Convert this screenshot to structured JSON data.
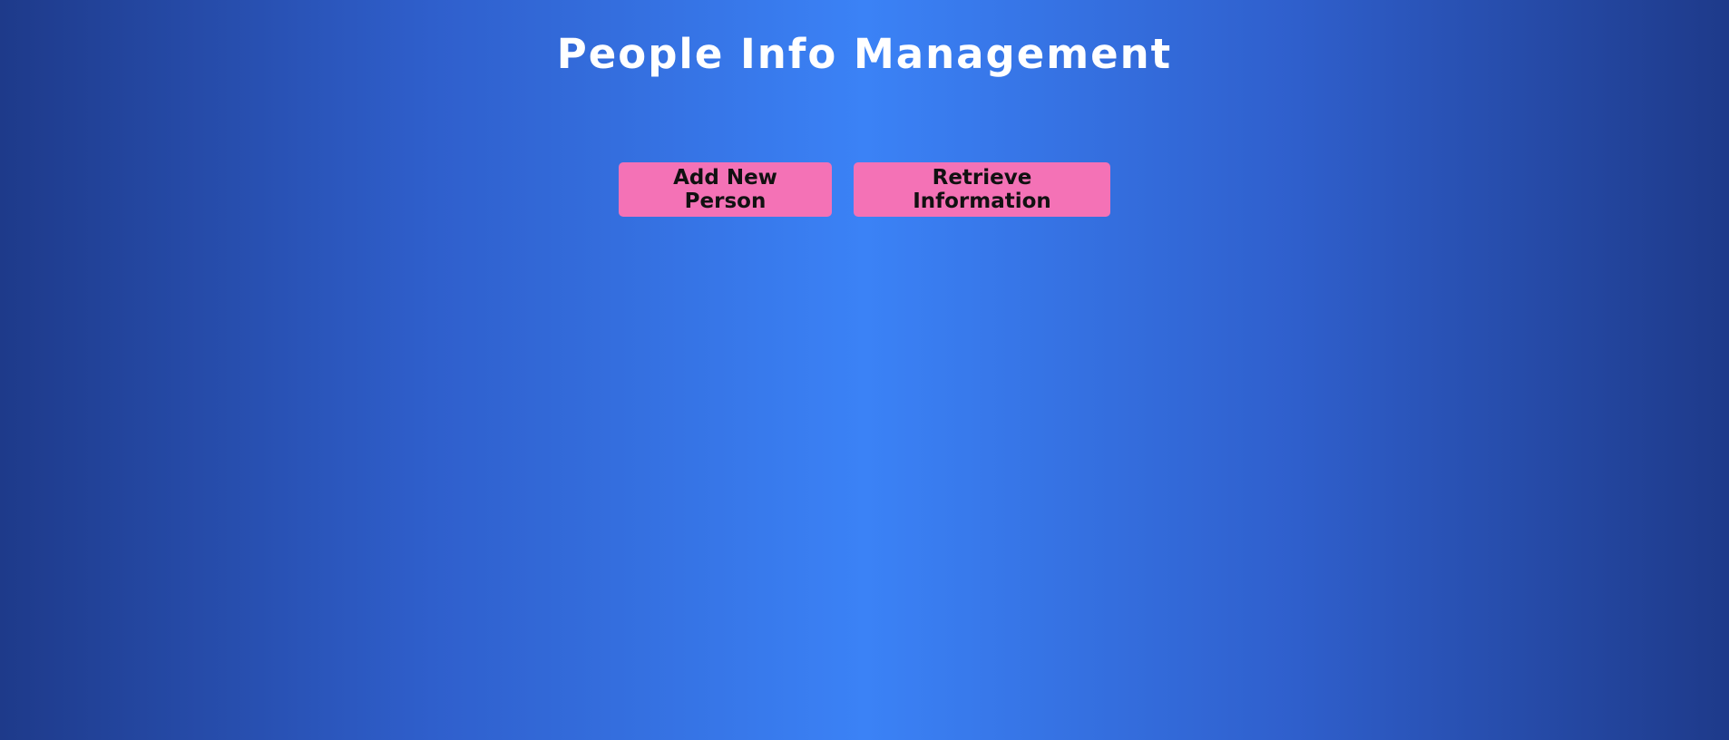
{
  "header": {
    "title": "People Info Management"
  },
  "actions": {
    "add_label": "Add New Person",
    "retrieve_label": "Retrieve Information"
  },
  "colors": {
    "background_center": "#3b82f6",
    "background_edge": "#1e3a8a",
    "button": "#f472b6",
    "title_text": "#ffffff",
    "button_text": "#111111"
  }
}
